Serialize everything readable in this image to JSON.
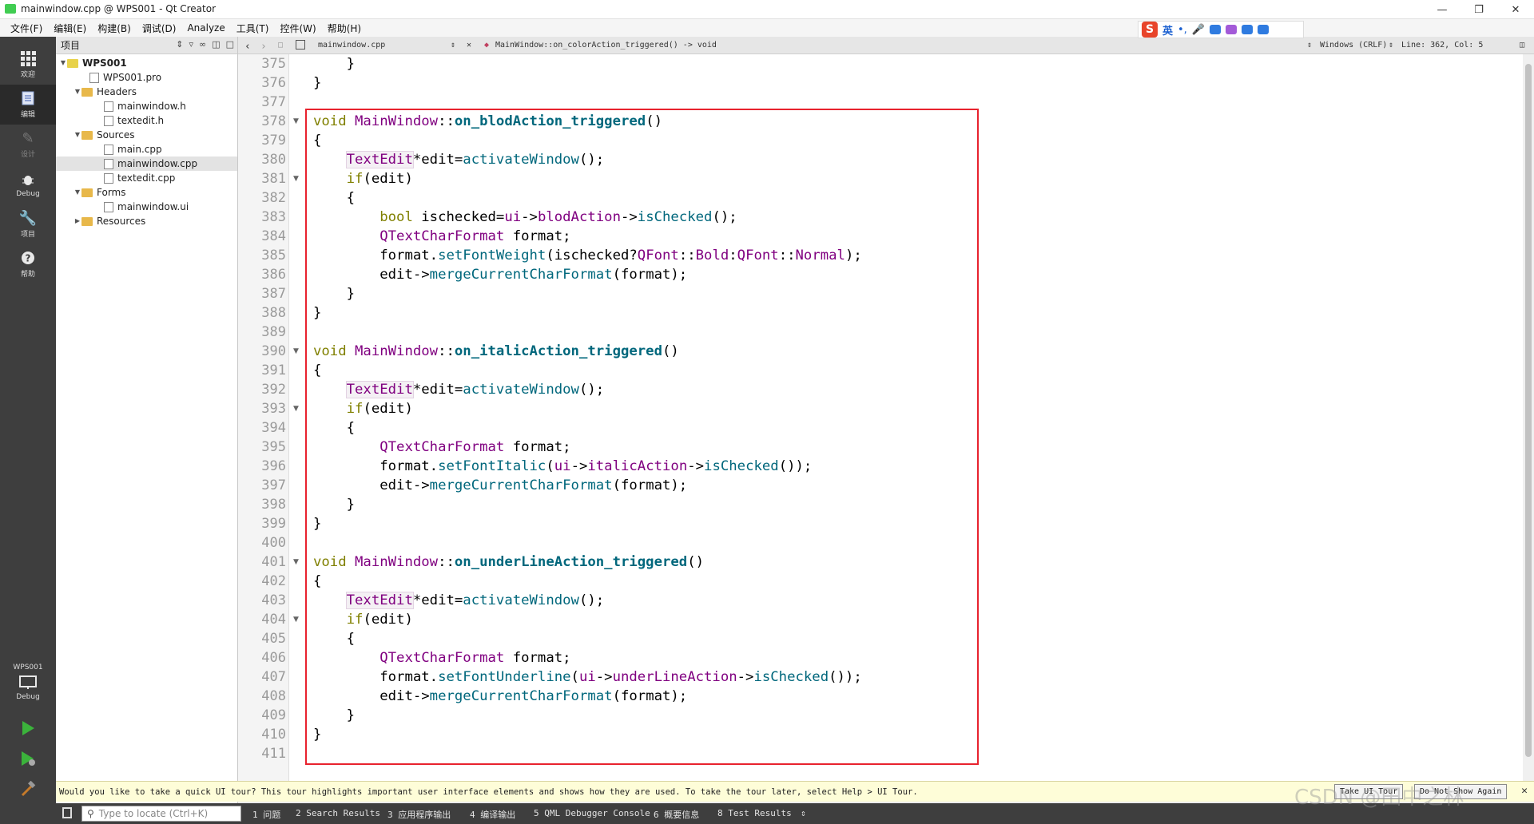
{
  "window": {
    "title": "mainwindow.cpp @ WPS001 - Qt Creator"
  },
  "ime": {
    "brand": "S",
    "lang": "英",
    "punct": "•,"
  },
  "menu": [
    "文件(F)",
    "编辑(E)",
    "构建(B)",
    "调试(D)",
    "Analyze",
    "工具(T)",
    "控件(W)",
    "帮助(H)"
  ],
  "modes": {
    "welcome": "欢迎",
    "edit": "编辑",
    "design": "设计",
    "debug": "Debug",
    "projects": "项目",
    "help": "帮助",
    "kit_project": "WPS001",
    "kit_mode": "Debug"
  },
  "project_panel": {
    "title": "项目"
  },
  "tree": {
    "root": "WPS001",
    "pro": "WPS001.pro",
    "headers": "Headers",
    "h1": "mainwindow.h",
    "h2": "textedit.h",
    "sources": "Sources",
    "s1": "main.cpp",
    "s2": "mainwindow.cpp",
    "s3": "textedit.cpp",
    "forms": "Forms",
    "f1": "mainwindow.ui",
    "resources": "Resources"
  },
  "editor_toolbar": {
    "file": "mainwindow.cpp",
    "symbol": "MainWindow::on_colorAction_triggered() -> void",
    "line_ending": "Windows (CRLF)",
    "position": "Line: 362, Col: 5"
  },
  "code": {
    "line_numbers": [
      "375",
      "376",
      "377",
      "378",
      "379",
      "380",
      "381",
      "382",
      "383",
      "384",
      "385",
      "386",
      "387",
      "388",
      "389",
      "390",
      "391",
      "392",
      "393",
      "394",
      "395",
      "396",
      "397",
      "398",
      "399",
      "400",
      "401",
      "402",
      "403",
      "404",
      "405",
      "406",
      "407",
      "408",
      "409",
      "410",
      "411"
    ]
  },
  "tour": {
    "message": "Would you like to take a quick UI tour? This tour highlights important user interface elements and shows how they are used. To take the tour later, select Help > UI Tour.",
    "take": "Take UI Tour",
    "dismiss": "Do Not Show Again"
  },
  "bottom": {
    "locate_placeholder": "Type to locate (Ctrl+K)",
    "tabs": [
      "1 问题",
      "2 Search Results",
      "3 应用程序输出",
      "4 编译输出",
      "5 QML Debugger Console",
      "6 概要信息",
      "8 Test Results"
    ]
  },
  "watermark": "CSDN @田中之林",
  "colors": {
    "highlight_box": "#e8222e",
    "keyword": "#808000",
    "type": "#800080",
    "function": "#00677c"
  }
}
